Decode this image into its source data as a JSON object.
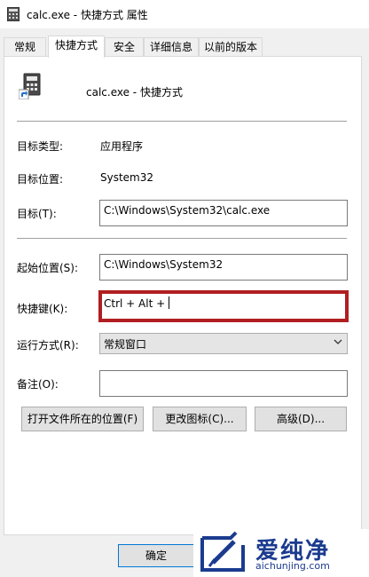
{
  "window": {
    "title": "calc.exe - 快捷方式 属性"
  },
  "tabs": [
    {
      "label": "常规"
    },
    {
      "label": "快捷方式",
      "active": true
    },
    {
      "label": "安全"
    },
    {
      "label": "详细信息"
    },
    {
      "label": "以前的版本"
    }
  ],
  "header": {
    "name": "calc.exe - 快捷方式"
  },
  "fields": {
    "target_type": {
      "label": "目标类型:",
      "value": "应用程序"
    },
    "target_location": {
      "label": "目标位置:",
      "value": "System32"
    },
    "target": {
      "label": "目标(T):",
      "value": "C:\\Windows\\System32\\calc.exe"
    },
    "start_in": {
      "label": "起始位置(S):",
      "value": "C:\\Windows\\System32"
    },
    "shortcut_key": {
      "label": "快捷键(K):",
      "value": "Ctrl + Alt +"
    },
    "run": {
      "label": "运行方式(R):",
      "value": "常规窗口"
    },
    "comment": {
      "label": "备注(O):",
      "value": ""
    }
  },
  "buttons": {
    "open_location": "打开文件所在的位置(F)",
    "change_icon": "更改图标(C)...",
    "advanced": "高级(D)..."
  },
  "footer": {
    "ok": "确定"
  },
  "watermark": {
    "text": "爱纯净",
    "url": "aichunjing.com"
  },
  "colors": {
    "highlight": "#b01e21",
    "watermark": "#1b3b8f"
  }
}
